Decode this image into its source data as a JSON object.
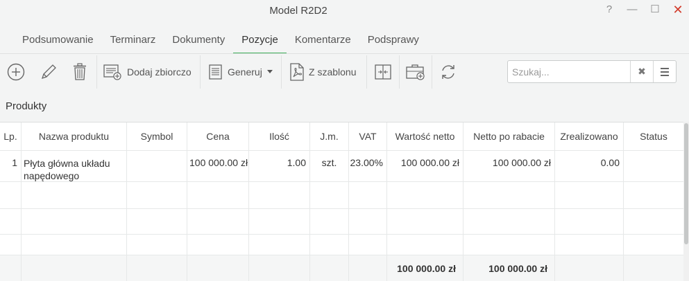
{
  "window": {
    "title": "Model R2D2",
    "help": "?",
    "minimize": "—",
    "maximize": "☐",
    "close": "✕"
  },
  "tabs": [
    {
      "label": "Podsumowanie"
    },
    {
      "label": "Terminarz"
    },
    {
      "label": "Dokumenty"
    },
    {
      "label": "Pozycje",
      "active": true
    },
    {
      "label": "Komentarze"
    },
    {
      "label": "Podsprawy"
    }
  ],
  "toolbar": {
    "add_icon": "plus-circle-icon",
    "edit_icon": "pencil-icon",
    "delete_icon": "trash-icon",
    "bulk_add_label": "Dodaj zbiorczo",
    "generate_label": "Generuj",
    "from_template_label": "Z szablonu",
    "split_icon": "split-icon",
    "briefcase_icon": "briefcase-add-icon",
    "refresh_icon": "refresh-icon"
  },
  "search": {
    "placeholder": "Szukaj...",
    "value": "",
    "clear_icon": "x-icon",
    "menu_icon": "menu-icon"
  },
  "section": {
    "title": "Produkty"
  },
  "table": {
    "columns": [
      "Lp.",
      "Nazwa produktu",
      "Symbol",
      "Cena",
      "Ilość",
      "J.m.",
      "VAT",
      "Wartość netto",
      "Netto po rabacie",
      "Zrealizowano",
      "Status"
    ],
    "rows": [
      {
        "lp": "1",
        "name": "Płyta główna układu napędowego",
        "symbol": "",
        "price": "100 000.00 zł",
        "qty": "1.00",
        "unit": "szt.",
        "vat": "23.00%",
        "net": "100 000.00 zł",
        "net_after_discount": "100 000.00 zł",
        "realized": "0.00",
        "status": ""
      }
    ],
    "totals": {
      "net": "100 000.00 zł",
      "net_after_discount": "100 000.00 zł"
    }
  },
  "colors": {
    "accent": "#3fae5a",
    "close": "#d23a2a",
    "background": "#f3f4f4"
  }
}
